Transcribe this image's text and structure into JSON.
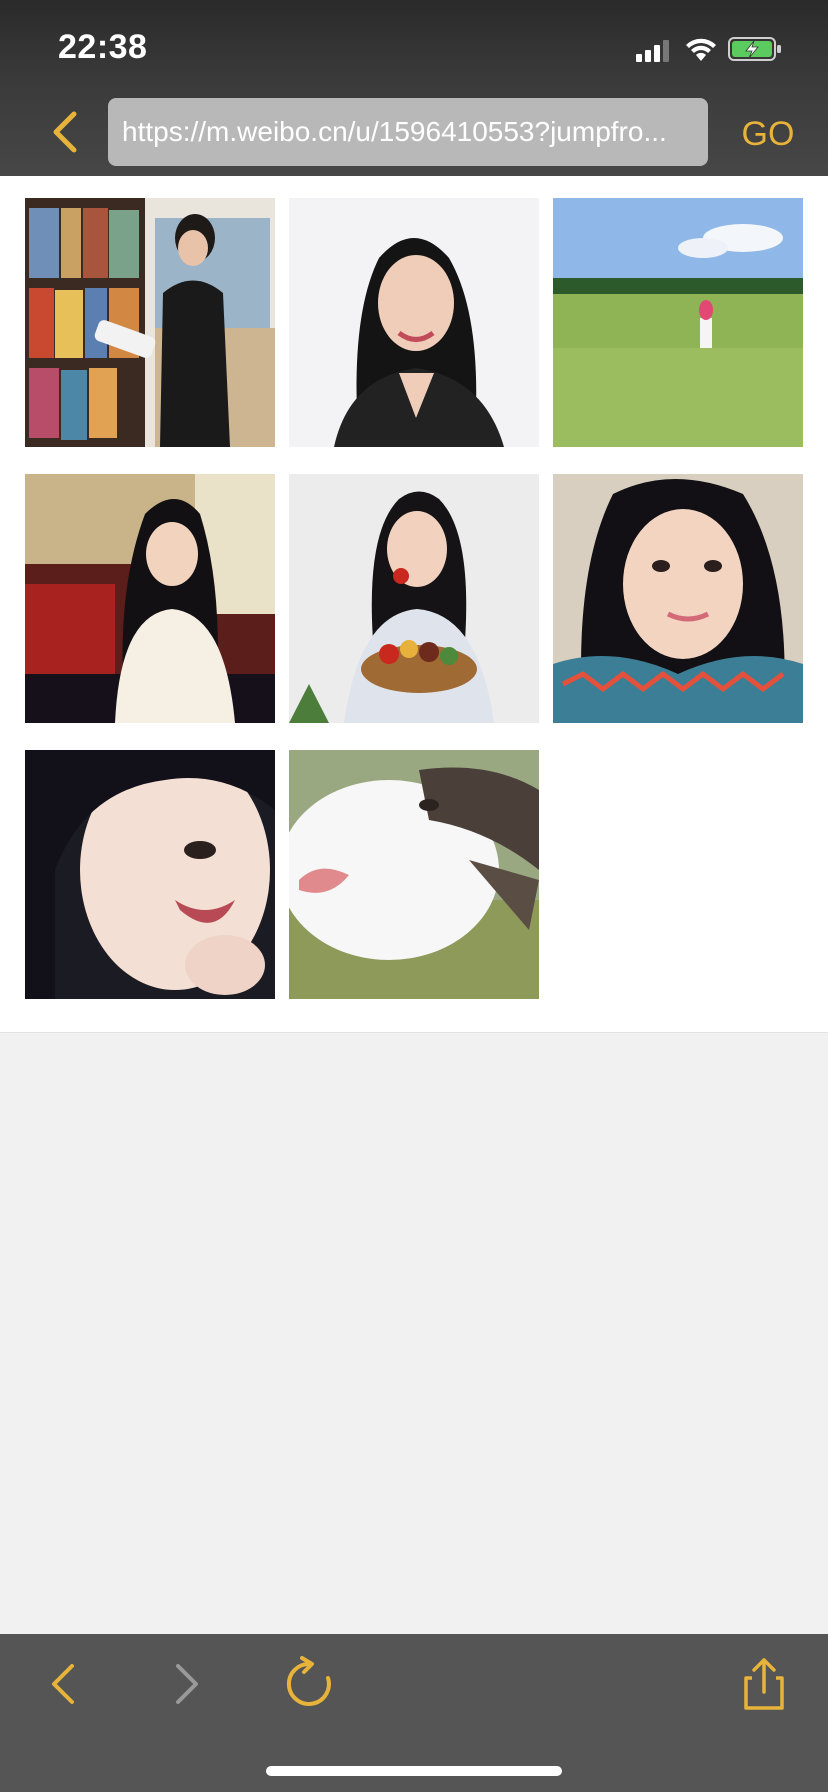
{
  "status_bar": {
    "time": "22:38"
  },
  "toolbar": {
    "url": "https://m.weibo.cn/u/1596410553?jumpfro...",
    "go_label": "GO",
    "back_icon": "chevron-left-icon"
  },
  "photos": [
    {
      "description": "woman-in-black-suit-at-bookshelf"
    },
    {
      "description": "woman-portrait-white-background"
    },
    {
      "description": "person-on-green-lawn-blue-sky"
    },
    {
      "description": "woman-in-white-sweater-red-chairs"
    },
    {
      "description": "woman-eating-tomato-basket"
    },
    {
      "description": "woman-selfie-in-car"
    },
    {
      "description": "woman-close-up-selfie"
    },
    {
      "description": "cat-sticking-out-tongue"
    }
  ],
  "bottom_bar": {
    "icons": [
      "back-icon",
      "forward-icon",
      "reload-icon",
      "share-icon"
    ]
  },
  "colors": {
    "accent": "#e7b33b",
    "toolbar_bg": "#474747",
    "bottom_bar_bg": "#555555",
    "url_field_bg": "#b8b8b8"
  }
}
